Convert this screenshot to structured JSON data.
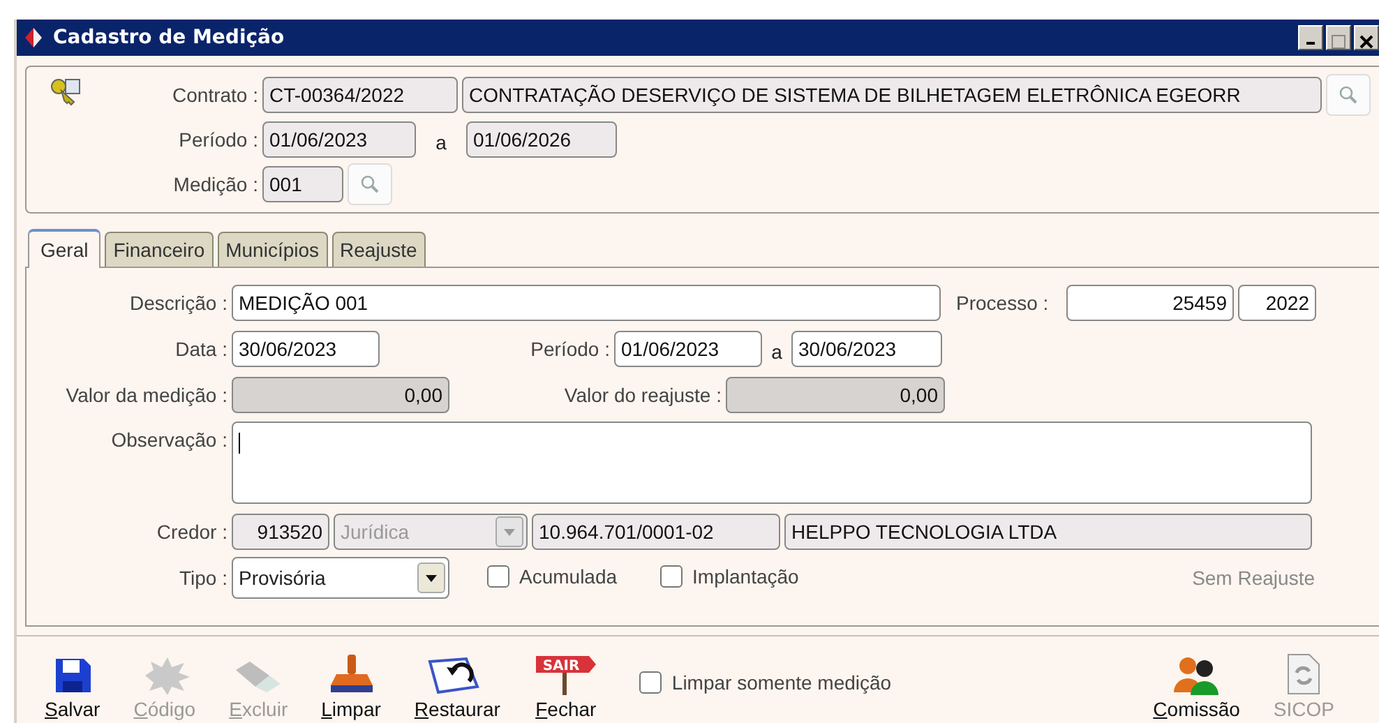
{
  "window": {
    "title": "Cadastro de Medição"
  },
  "header": {
    "contrato_label": "Contrato :",
    "contrato_code": "CT-00364/2022",
    "contrato_desc": "CONTRATAÇÃO DESERVIÇO DE SISTEMA DE BILHETAGEM ELETRÔNICA EGEORR",
    "periodo_label": "Período :",
    "periodo_start": "01/06/2023",
    "periodo_sep": "a",
    "periodo_end": "01/06/2026",
    "medicao_label": "Medição :",
    "medicao": "001"
  },
  "tabs": [
    {
      "label": "Geral",
      "selected": true
    },
    {
      "label": "Financeiro",
      "selected": false
    },
    {
      "label": "Municípios",
      "selected": false
    },
    {
      "label": "Reajuste",
      "selected": false
    }
  ],
  "form": {
    "descricao_label": "Descrição :",
    "descricao": "MEDIÇÃO 001",
    "processo_label": "Processo :",
    "processo_numero": "25459",
    "processo_ano": "2022",
    "data_label": "Data :",
    "data": "30/06/2023",
    "periodo_label": "Período :",
    "periodo_start": "01/06/2023",
    "periodo_sep": "a",
    "periodo_end": "30/06/2023",
    "valor_medicao_label": "Valor da medição :",
    "valor_medicao": "0,00",
    "valor_reajuste_label": "Valor do reajuste :",
    "valor_reajuste": "0,00",
    "observacao_label": "Observação :",
    "credor_label": "Credor :",
    "credor_codigo": "913520",
    "credor_tipo": {
      "value": "Jurídica",
      "disabled": true
    },
    "credor_cnpj": "10.964.701/0001-02",
    "credor_nome": "HELPPO TECNOLOGIA LTDA",
    "tipo_label": "Tipo :",
    "tipo": {
      "value": "Provisória",
      "disabled": false
    },
    "acumulada": {
      "label": "Acumulada",
      "checked": false
    },
    "implantacao": {
      "label": "Implantação",
      "checked": false
    },
    "reajuste_status": "Sem Reajuste"
  },
  "toolbar": [
    {
      "kind": "floppy",
      "label": "Salvar",
      "disabled": false
    },
    {
      "kind": "splash",
      "label": "Código",
      "disabled": true
    },
    {
      "kind": "eraser",
      "label": "Excluir",
      "disabled": true
    },
    {
      "kind": "stamp",
      "label": "Limpar",
      "disabled": false
    },
    {
      "kind": "restore",
      "label": "Restaurar",
      "disabled": false
    },
    {
      "kind": "sign",
      "label": "Fechar",
      "disabled": false,
      "sign_text": "SAIR"
    }
  ],
  "limpar_somente": {
    "label": "Limpar somente medição",
    "checked": false
  },
  "toolbar_right": [
    {
      "kind": "people",
      "label": "Comissão",
      "disabled": false
    },
    {
      "kind": "document",
      "label": "SICOP",
      "disabled": true
    }
  ]
}
